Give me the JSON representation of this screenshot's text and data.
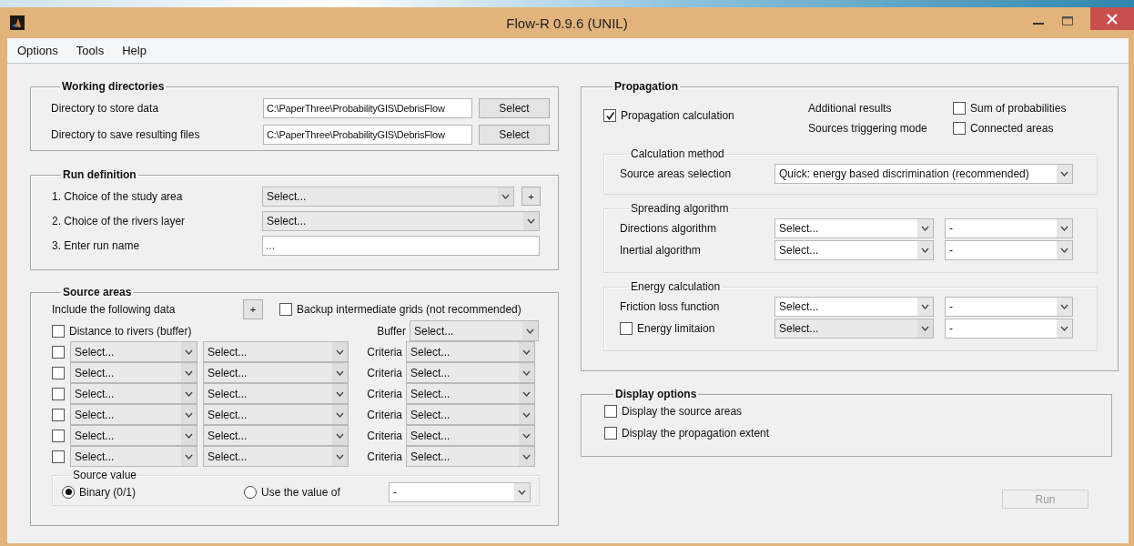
{
  "window": {
    "title": "Flow-R 0.9.6 (UNIL)"
  },
  "menu": [
    {
      "label": "Options"
    },
    {
      "label": "Tools"
    },
    {
      "label": "Help"
    }
  ],
  "working_directories": {
    "title": "Working directories",
    "rows": [
      {
        "label": "Directory to store data",
        "value": "C:\\PaperThree\\ProbabilityGIS\\DebrisFlow",
        "button": "Select"
      },
      {
        "label": "Directory to save resulting files",
        "value": "C:\\PaperThree\\ProbabilityGIS\\DebrisFlow",
        "button": "Select"
      }
    ]
  },
  "run_definition": {
    "title": "Run definition",
    "rows": [
      {
        "kind": "dropdown",
        "label": "1. Choice of the study area",
        "dropdown": {
          "value": "Select...",
          "disabled": true
        },
        "add_button": "+"
      },
      {
        "kind": "dropdown",
        "label": "2. Choice of the rivers layer",
        "dropdown": {
          "value": "Select...",
          "disabled": true
        }
      },
      {
        "kind": "text",
        "label": "3. Enter run name",
        "value": "..."
      }
    ]
  },
  "source_areas": {
    "title": "Source areas",
    "include_label": "Include the following data",
    "add_button": "+",
    "backup": {
      "label": "Backup intermediate grids (not recommended)",
      "checked": false
    },
    "distance": {
      "label": "Distance to rivers (buffer)",
      "checked": false,
      "buffer_label": "Buffer",
      "buffer": {
        "value": "Select...",
        "disabled": true
      }
    },
    "criteria_rows": [
      {
        "checked": false,
        "layer": {
          "value": "Select...",
          "disabled": true
        },
        "class": {
          "value": "Select...",
          "disabled": true
        },
        "criteria_label": "Criteria",
        "criteria": {
          "value": "Select...",
          "disabled": true
        }
      },
      {
        "checked": false,
        "layer": {
          "value": "Select...",
          "disabled": true
        },
        "class": {
          "value": "Select...",
          "disabled": true
        },
        "criteria_label": "Criteria",
        "criteria": {
          "value": "Select...",
          "disabled": true
        }
      },
      {
        "checked": false,
        "layer": {
          "value": "Select...",
          "disabled": true
        },
        "class": {
          "value": "Select...",
          "disabled": true
        },
        "criteria_label": "Criteria",
        "criteria": {
          "value": "Select...",
          "disabled": true
        }
      },
      {
        "checked": false,
        "layer": {
          "value": "Select...",
          "disabled": true
        },
        "class": {
          "value": "Select...",
          "disabled": true
        },
        "criteria_label": "Criteria",
        "criteria": {
          "value": "Select...",
          "disabled": true
        }
      },
      {
        "checked": false,
        "layer": {
          "value": "Select...",
          "disabled": true
        },
        "class": {
          "value": "Select...",
          "disabled": true
        },
        "criteria_label": "Criteria",
        "criteria": {
          "value": "Select...",
          "disabled": true
        }
      },
      {
        "checked": false,
        "layer": {
          "value": "Select...",
          "disabled": true
        },
        "class": {
          "value": "Select...",
          "disabled": true
        },
        "criteria_label": "Criteria",
        "criteria": {
          "value": "Select...",
          "disabled": true
        }
      }
    ],
    "source_value": {
      "title": "Source value",
      "options": [
        {
          "label": "Binary (0/1)",
          "selected": true
        },
        {
          "label": "Use the value of",
          "selected": false
        }
      ],
      "dropdown": {
        "value": "-",
        "disabled": false
      }
    }
  },
  "propagation": {
    "title": "Propagation",
    "calculation": {
      "label": "Propagation calculation",
      "checked": true
    },
    "additional_label": "Additional results",
    "triggering_label": "Sources triggering mode",
    "sum": {
      "label": "Sum of probabilities",
      "checked": false
    },
    "connected": {
      "label": "Connected areas",
      "checked": false
    },
    "groups": [
      {
        "title": "Calculation method",
        "rows": [
          {
            "kind": "label",
            "label": "Source areas selection",
            "dropdowns": [
              {
                "value": "Quick: energy based discrimination (recommended)",
                "disabled": false
              }
            ]
          }
        ]
      },
      {
        "title": "Spreading algorithm",
        "rows": [
          {
            "kind": "label",
            "label": "Directions algorithm",
            "dropdowns": [
              {
                "value": "Select...",
                "disabled": false
              },
              {
                "value": "-",
                "disabled": false
              }
            ]
          },
          {
            "kind": "label",
            "label": "Inertial algorithm",
            "dropdowns": [
              {
                "value": "Select...",
                "disabled": false
              },
              {
                "value": "-",
                "disabled": false
              }
            ]
          }
        ]
      },
      {
        "title": "Energy calculation",
        "rows": [
          {
            "kind": "label",
            "label": "Friction loss function",
            "dropdowns": [
              {
                "value": "Select...",
                "disabled": false
              },
              {
                "value": "-",
                "disabled": false
              }
            ]
          },
          {
            "kind": "checkbox",
            "label": "Energy limitaion",
            "checked": false,
            "dropdowns": [
              {
                "value": "Select...",
                "disabled": true
              },
              {
                "value": "-",
                "disabled": false
              }
            ]
          }
        ]
      }
    ]
  },
  "display_options": {
    "title": "Display options",
    "options": [
      {
        "label": "Display the source areas",
        "checked": false
      },
      {
        "label": "Display the propagation extent",
        "checked": false
      }
    ]
  },
  "run_button": {
    "label": "Run",
    "disabled": true
  }
}
